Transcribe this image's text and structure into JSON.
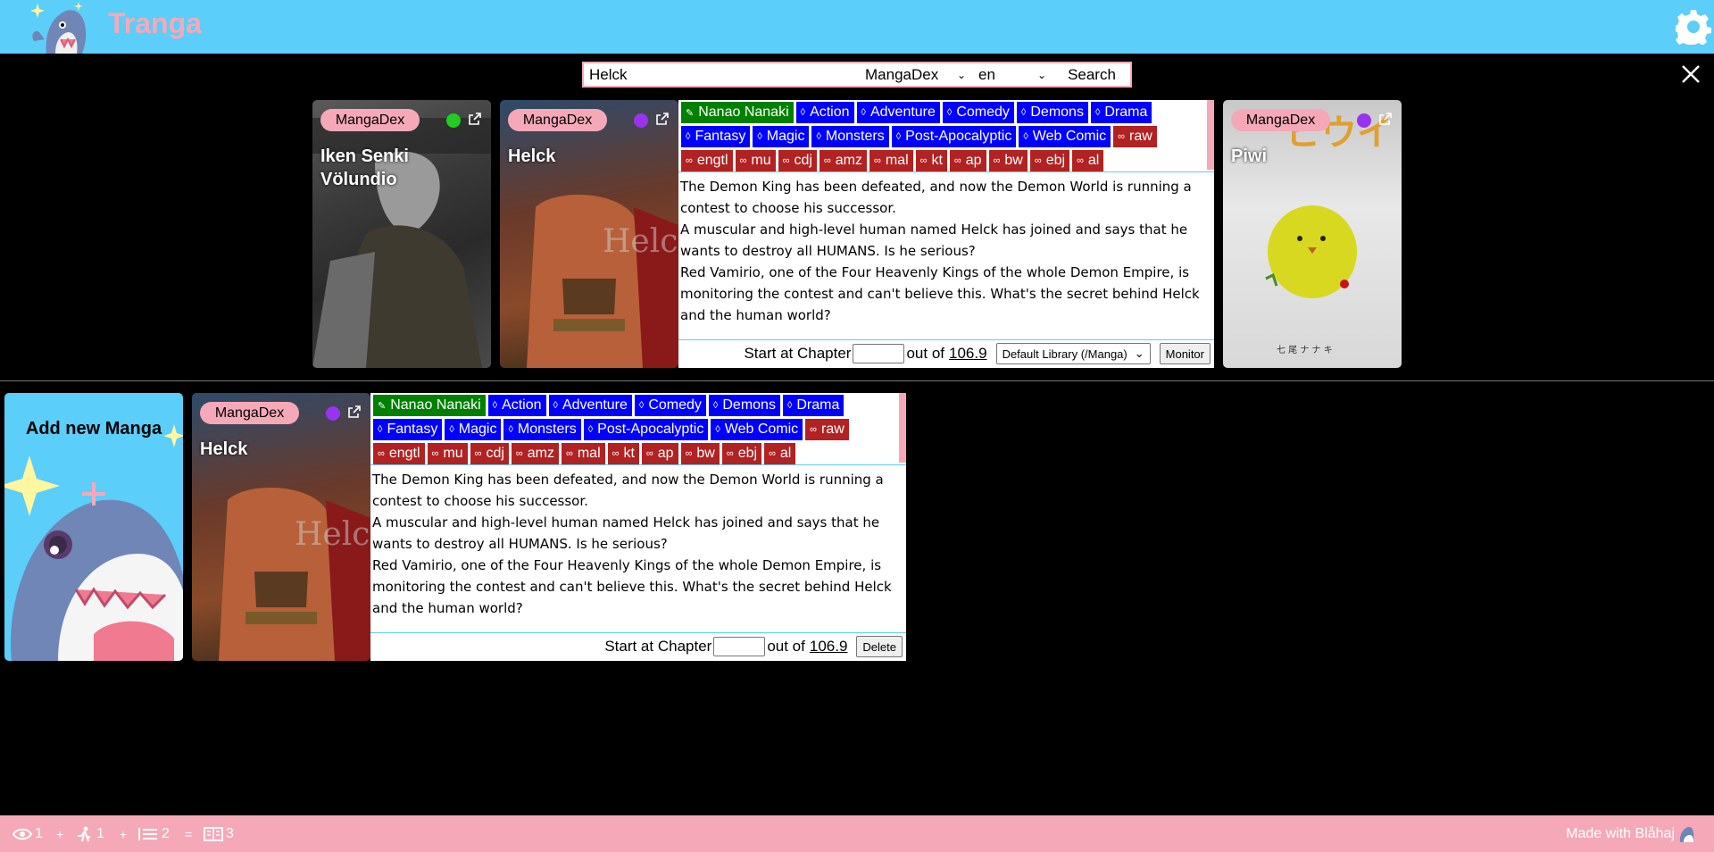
{
  "app": {
    "title": "Tranga"
  },
  "search": {
    "query": "Helck",
    "connector": "MangaDex",
    "language": "en",
    "button": "Search"
  },
  "colors": {
    "header": "#5bcefa",
    "accent_pink": "#f5a9b8",
    "author_tag": "#008000",
    "genre_tag": "#0000ff",
    "link_tag": "#b22222",
    "status_ongoing": "#00c800",
    "status_unknown": "#8a2be2"
  },
  "search_results": [
    {
      "connector": "MangaDex",
      "title": "Iken Senki Völundio",
      "status_color": "#22cc22"
    },
    {
      "connector": "MangaDex",
      "title": "Helck",
      "status_color": "#9933ee"
    },
    {
      "connector": "MangaDex",
      "title": "Piwi",
      "status_color": "#9933ee"
    }
  ],
  "details": {
    "author": "Nanao Nanaki",
    "genres": [
      "Action",
      "Adventure",
      "Comedy",
      "Demons",
      "Drama",
      "Fantasy",
      "Magic",
      "Monsters",
      "Post-Apocalyptic",
      "Web Comic"
    ],
    "links": [
      "raw",
      "engtl",
      "mu",
      "cdj",
      "amz",
      "mal",
      "kt",
      "ap",
      "bw",
      "ebj",
      "al"
    ],
    "description": [
      "The Demon King has been defeated, and now the Demon World is running a contest to choose his successor.",
      "A muscular and high-level human named Helck has joined and says that he wants to destroy all HUMANS. Is he serious?",
      "Red Vamirio, one of the Four Heavenly Kings of the whole Demon Empire, is monitoring the contest and can't believe this. What's the secret behind Helck and the human world?"
    ],
    "start_label": "Start at Chapter",
    "start_value": "",
    "out_of": "out of",
    "max_chapter": "106.9",
    "library": "Default Library (/Manga)",
    "monitor_button": "Monitor"
  },
  "library": {
    "add_label": "Add new Manga",
    "manga": {
      "connector": "MangaDex",
      "title": "Helck",
      "status_color": "#9933ee"
    },
    "delete_button": "Delete"
  },
  "footer": {
    "monitored": "1",
    "running": "1",
    "queued": "2",
    "total": "3",
    "plus": "+",
    "equals": "=",
    "credit": "Made with Blåhaj"
  }
}
